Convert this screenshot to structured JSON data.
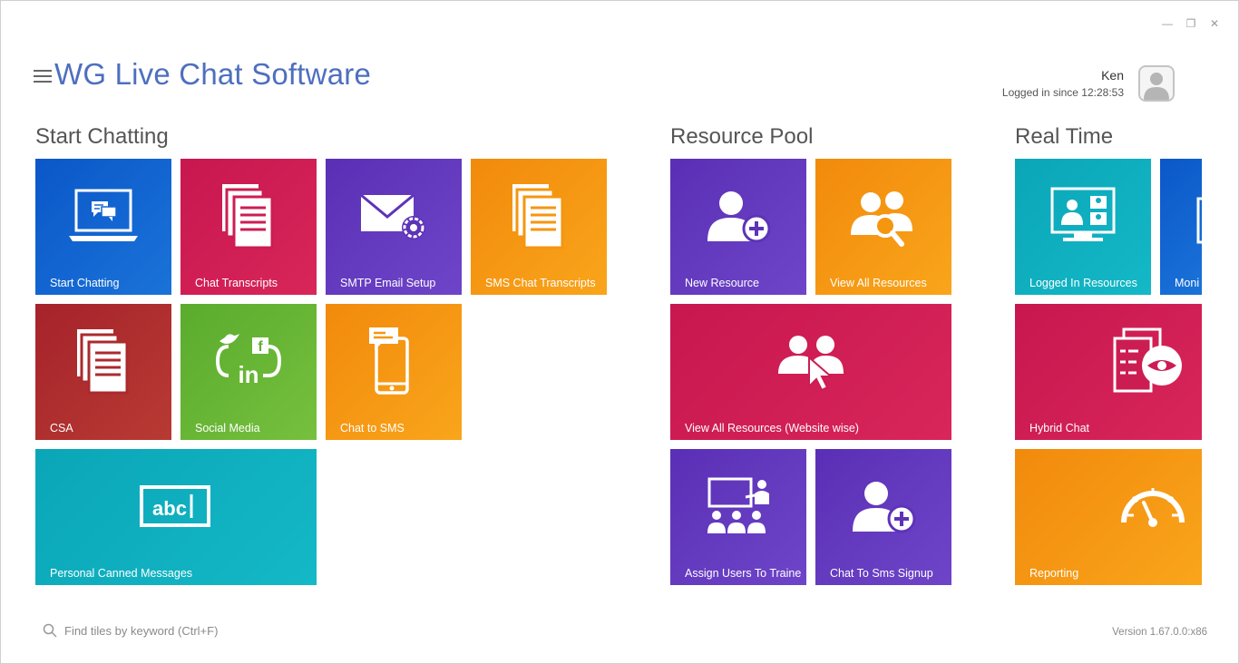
{
  "window": {
    "minimize": "—",
    "restore": "❐",
    "close": "✕"
  },
  "app": {
    "title": "WG Live Chat Software"
  },
  "user": {
    "name": "Ken",
    "status": "Logged in since 12:28:53"
  },
  "groups": {
    "start_chatting": {
      "title": "Start Chatting",
      "tiles": {
        "start_chatting": "Start Chatting",
        "chat_transcripts": "Chat Transcripts",
        "smtp_email_setup": "SMTP Email Setup",
        "sms_chat_transcripts": "SMS Chat Transcripts",
        "csa": "CSA",
        "social_media": "Social Media",
        "chat_to_sms": "Chat to SMS",
        "personal_canned_messages": "Personal Canned Messages"
      }
    },
    "resource_pool": {
      "title": "Resource Pool",
      "tiles": {
        "new_resource": "New Resource",
        "view_all_resources": "View All Resources",
        "view_all_resources_website": "View All Resources (Website wise)",
        "assign_users_to_traine": "Assign Users To Traine",
        "chat_to_sms_signup": "Chat To Sms Signup"
      }
    },
    "real_time": {
      "title": "Real Time",
      "tiles": {
        "logged_in_resources": "Logged In Resources",
        "monitor": "Moni",
        "hybrid_chat": "Hybrid Chat",
        "reporting": "Reporting"
      }
    }
  },
  "icon_text": {
    "abc": "abc",
    "in": "in",
    "f": "f"
  },
  "footer": {
    "search_placeholder": "Find tiles by keyword (Ctrl+F)",
    "version": "Version 1.67.0.0:x86"
  },
  "colors": {
    "title": "#4e6fbf",
    "blue": "#0b57c9",
    "crimson": "#c8174f",
    "purple": "#5a2fb5",
    "orange": "#f28a0c",
    "red": "#a6232b",
    "green": "#5aab2d",
    "teal": "#0aa6b8"
  }
}
